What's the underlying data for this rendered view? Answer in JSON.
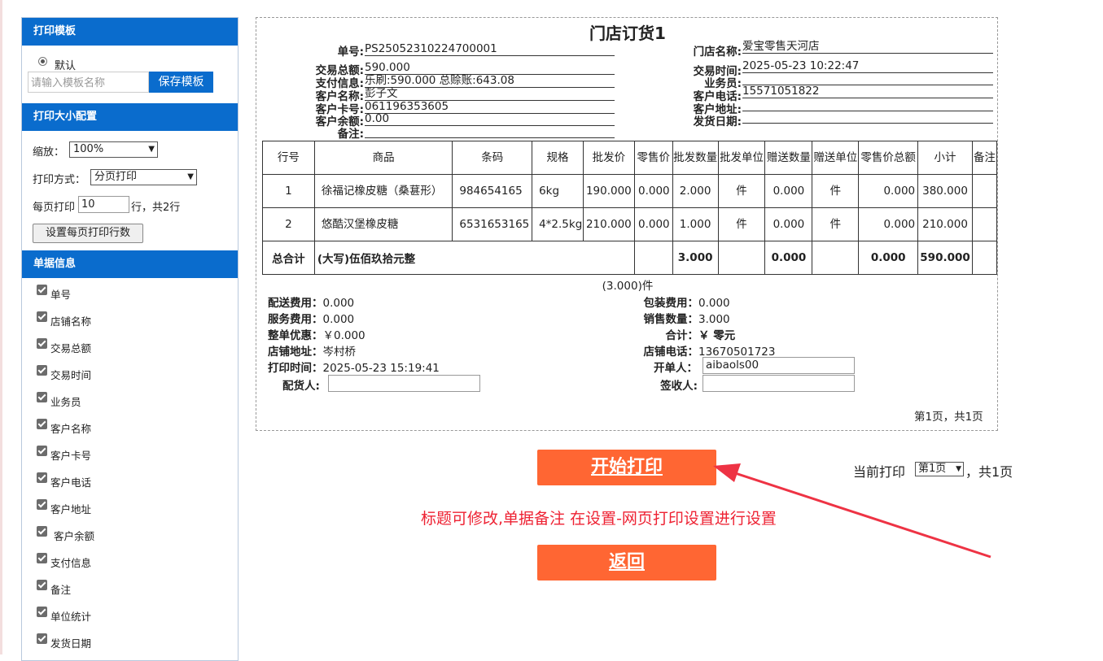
{
  "left_panel": {
    "template_section": {
      "title": "打印模板",
      "default_label": "默认",
      "template_input_placeholder": "请输入模板名称",
      "save_button": "保存模板"
    },
    "size_section": {
      "title": "打印大小配置",
      "zoom_label": "缩放：",
      "zoom_value": "100%",
      "print_mode_label": "打印方式：",
      "print_mode_value": "分页打印",
      "rows_per_page_label": "每页打印",
      "rows_per_page_value": "10",
      "rows_suffix": "行，共2行",
      "set_rows_button": "设置每页打印行数"
    },
    "doc_info_section": {
      "title": "单据信息",
      "checkboxes": [
        "单号",
        "店铺名称",
        "交易总额",
        "交易时间",
        "业务员",
        "客户名称",
        "客户卡号",
        "客户电话",
        "客户地址",
        "客户余额",
        "支付信息",
        "备注",
        "单位统计",
        "发货日期"
      ]
    }
  },
  "print_doc": {
    "title": "门店订货1",
    "header_left": [
      {
        "label": "单号:",
        "value": "PS25052310224700001"
      },
      {
        "label": "交易总额:",
        "value": "590.000"
      },
      {
        "label": "支付信息:",
        "value": "乐刷:590.000 总赊账:643.08"
      },
      {
        "label": "客户名称:",
        "value": "彭子文"
      },
      {
        "label": "客户卡号:",
        "value": "061196353605"
      },
      {
        "label": "客户余额:",
        "value": "0.00"
      },
      {
        "label": "备注:",
        "value": ""
      }
    ],
    "header_right": [
      {
        "label": "门店名称:",
        "value": "爱宝零售天河店"
      },
      {
        "label": "交易时间:",
        "value": "2025-05-23 10:22:47"
      },
      {
        "label": "业务员:",
        "value": ""
      },
      {
        "label": "客户电话:",
        "value": "15571051822"
      },
      {
        "label": "客户地址:",
        "value": ""
      },
      {
        "label": "发货日期:",
        "value": ""
      }
    ],
    "table": {
      "headers": [
        "行号",
        "商品",
        "条码",
        "规格",
        "批发价",
        "零售价",
        "批发数量",
        "批发单位",
        "赠送数量",
        "赠送单位",
        "零售价总额",
        "小计",
        "备注"
      ],
      "rows": [
        [
          "1",
          "徐福记橡皮糖（桑葚形）",
          "984654165",
          "6kg",
          "190.000",
          "0.000",
          "2.000",
          "件",
          "0.000",
          "件",
          "0.000",
          "380.000",
          ""
        ],
        [
          "2",
          "悠酷汉堡橡皮糖",
          "6531653165",
          "4*2.5kg",
          "210.000",
          "0.000",
          "1.000",
          "件",
          "0.000",
          "件",
          "0.000",
          "210.000",
          ""
        ]
      ],
      "total": {
        "label": "总合计",
        "words": "(大写)伍佰玖拾元整",
        "wholesale_qty": "3.000",
        "gift_qty": "0.000",
        "retail_total": "0.000",
        "subtotal": "590.000"
      }
    },
    "unit_summary": "(3.000)件",
    "footer_left": [
      {
        "label": "配送费用：",
        "value": "0.000"
      },
      {
        "label": "服务费用：",
        "value": "0.000"
      },
      {
        "label": "整单优惠：",
        "value": "￥0.000"
      },
      {
        "label": "店铺地址：",
        "value": "岑村桥"
      },
      {
        "label": "打印时间：",
        "value": "2025-05-23 15:19:41"
      }
    ],
    "footer_right": [
      {
        "label": "包装费用：",
        "value": "0.000"
      },
      {
        "label": "销售数量：",
        "value": "3.000"
      },
      {
        "label": "合计：",
        "value": "￥ 零元"
      },
      {
        "label": "店铺电话：",
        "value": "13670501723"
      }
    ],
    "dispatcher_label": "配货人:",
    "dispatcher_value": "",
    "creator_label": "开单人：",
    "creator_value": "aibaols00",
    "receiver_label": "签收人:",
    "receiver_value": "",
    "page_info": "第1页，共1页"
  },
  "actions": {
    "print_button": "开始打印",
    "current_print_label": "当前打印",
    "page_select_value": "第1页",
    "total_pages": "，共1页",
    "note": "标题可修改,单据备注 在设置-网页打印设置进行设置",
    "back_button": "返回"
  },
  "colors": {
    "brand_blue": "#0a6ccd",
    "action_orange": "#ff6633",
    "note_red": "#ee2233"
  }
}
